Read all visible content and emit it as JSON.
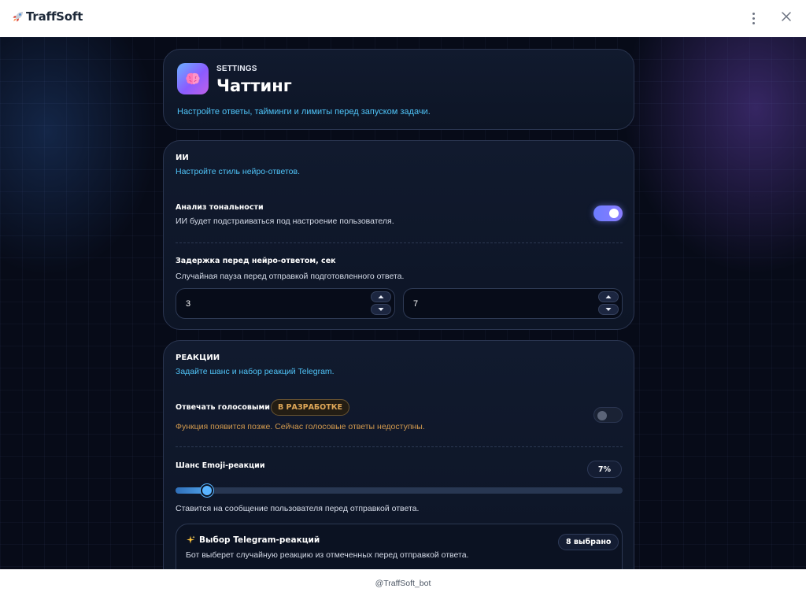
{
  "app": {
    "title": "TraffSoft"
  },
  "header": {
    "kicker": "SETTINGS",
    "title": "Чаттинг",
    "description": "Настройте ответы, тайминги и лимиты перед запуском задачи."
  },
  "ai_section": {
    "title": "ИИ",
    "subtitle": "Настройте стиль нейро-ответов.",
    "tone": {
      "label": "Анализ тональности",
      "description": "ИИ будет подстраиваться под настроение пользователя.",
      "enabled": true
    },
    "delay": {
      "label": "Задержка перед нейро-ответом, сек",
      "description": "Случайная пауза перед отправкой подготовленного ответа.",
      "min": "3",
      "max": "7"
    }
  },
  "reactions_section": {
    "title": "РЕАКЦИИ",
    "subtitle": "Задайте шанс и набор реакций Telegram.",
    "voice": {
      "label": "Отвечать голосовыми",
      "badge": "В РАЗРАБОТКЕ",
      "warning": "Функция появится позже. Сейчас голосовые ответы недоступны.",
      "enabled": false
    },
    "emoji_chance": {
      "label": "Шанс Emoji-реакции",
      "value_text": "7%",
      "value": 7,
      "max": 100,
      "description": "Ставится на сообщение пользователя перед отправкой ответа."
    },
    "telegram_reactions": {
      "title": "Выбор Telegram-реакций",
      "description": "Бот выберет случайную реакцию из отмеченных перед отправкой ответа.",
      "selected": "8 выбрано"
    }
  },
  "footer": {
    "text": "@TraffSoft_bot"
  },
  "colors": {
    "accent": "#4fc3f7",
    "toggle_on": "#7b80ff",
    "warning": "#d49a4e",
    "background": "#070b18"
  },
  "icons": {
    "brand": "rocket-icon",
    "menu": "kebab-menu-icon",
    "close": "close-icon",
    "header": "brain-icon",
    "reactions": "sparkles-icon"
  }
}
